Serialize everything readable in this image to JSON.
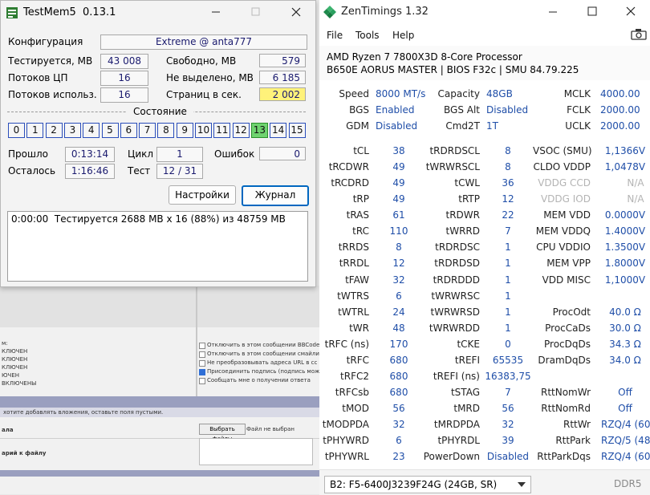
{
  "testmem": {
    "title": "TestMem5  0.13.1",
    "config_label": "Конфигурация",
    "config_value": "Extreme @ anta777",
    "tested_label": "Тестируется, МВ",
    "tested_value": "43 008",
    "free_label": "Свободно, МВ",
    "free_value": "579",
    "cpu_threads_label": "Потоков ЦП",
    "cpu_threads_value": "16",
    "unallocated_label": "Не выделено, МВ",
    "unallocated_value": "6 185",
    "used_threads_label": "Потоков использ.",
    "used_threads_value": "16",
    "pages_label": "Страниц в сек.",
    "pages_value": "2 002",
    "state_label": "Состояние",
    "segments": [
      "0",
      "1",
      "2",
      "3",
      "4",
      "5",
      "6",
      "7",
      "8",
      "9",
      "10",
      "11",
      "12",
      "13",
      "14",
      "15"
    ],
    "active_segment": "13",
    "elapsed_label": "Прошло",
    "elapsed_value": "0:13:14",
    "cycle_label": "Цикл",
    "cycle_value": "1",
    "errors_label": "Ошибок",
    "errors_value": "0",
    "remaining_label": "Осталось",
    "remaining_value": "1:16:46",
    "test_label": "Тест",
    "test_value": "12 / 31",
    "settings_button": "Настройки",
    "log_button": "Журнал",
    "log_line": "0:00:00  Тестируется 2688 МВ x 16 (88%) из 48759 МВ"
  },
  "background": {
    "items": [
      "Отключить в этом сообщении BBCode",
      "Отключить в этом сообщении смайлик",
      "Не преобразовывать адреса URL в сс",
      "Присоединить подпись (подпись можн",
      "Сообщать мне о получении ответа"
    ],
    "left_fragments": [
      "м:",
      "КЛЮЧЕН",
      "КЛЮЧЕН",
      "КЛЮЧЕН",
      "ЮЧЕН",
      "ВКЛЮЧЕНЫ"
    ],
    "attach_hint": "хотите добавлять вложения, оставьте поля пустыми.",
    "file_label": "ала",
    "comment_label": "арий к файлу",
    "choose_file_button": "Выбрать файлы",
    "no_file_text": "Файл не выбран"
  },
  "zentimings": {
    "title": "ZenTimings 1.32",
    "menu": [
      "File",
      "Tools",
      "Help"
    ],
    "cpu": "AMD Ryzen 7 7800X3D 8-Core Processor",
    "board": "B650E AORUS MASTER | BIOS F32c | SMU 84.79.225",
    "top_rows": [
      {
        "l1": "Speed",
        "v1": "8000 MT/s",
        "l2": "Capacity",
        "v2": "48GB",
        "l3": "MCLK",
        "v3": "4000.00"
      },
      {
        "l1": "BGS",
        "v1": "Enabled",
        "l2": "BGS Alt",
        "v2": "Disabled",
        "l3": "FCLK",
        "v3": "2000.00"
      },
      {
        "l1": "GDM",
        "v1": "Disabled",
        "l2": "Cmd2T",
        "v2": "1T",
        "l3": "UCLK",
        "v3": "2000.00"
      }
    ],
    "timing_rows": [
      {
        "l1": "tCL",
        "v1": "38",
        "l2": "tRDRDSCL",
        "v2": "8",
        "l3": "VSOC (SMU)",
        "v3": "1,1366V",
        "dis": false
      },
      {
        "l1": "tRCDWR",
        "v1": "49",
        "l2": "tWRWRSCL",
        "v2": "8",
        "l3": "CLDO VDDP",
        "v3": "1,0478V",
        "dis": false
      },
      {
        "l1": "tRCDRD",
        "v1": "49",
        "l2": "tCWL",
        "v2": "36",
        "l3": "VDDG CCD",
        "v3": "N/A",
        "dis": true
      },
      {
        "l1": "tRP",
        "v1": "49",
        "l2": "tRTP",
        "v2": "12",
        "l3": "VDDG IOD",
        "v3": "N/A",
        "dis": true
      },
      {
        "l1": "tRAS",
        "v1": "61",
        "l2": "tRDWR",
        "v2": "22",
        "l3": "MEM VDD",
        "v3": "0.0000V",
        "dis": false
      },
      {
        "l1": "tRC",
        "v1": "110",
        "l2": "tWRRD",
        "v2": "7",
        "l3": "MEM VDDQ",
        "v3": "1.4000V",
        "dis": false
      },
      {
        "l1": "tRRDS",
        "v1": "8",
        "l2": "tRDRDSC",
        "v2": "1",
        "l3": "CPU VDDIO",
        "v3": "1.3500V",
        "dis": false
      },
      {
        "l1": "tRRDL",
        "v1": "12",
        "l2": "tRDRDSD",
        "v2": "1",
        "l3": "MEM VPP",
        "v3": "1.8000V",
        "dis": false
      },
      {
        "l1": "tFAW",
        "v1": "32",
        "l2": "tRDRDDD",
        "v2": "1",
        "l3": "VDD MISC",
        "v3": "1,1000V",
        "dis": false
      },
      {
        "l1": "tWTRS",
        "v1": "6",
        "l2": "tWRWRSC",
        "v2": "1",
        "l3": "",
        "v3": "",
        "dis": false
      },
      {
        "l1": "tWTRL",
        "v1": "24",
        "l2": "tWRWRSD",
        "v2": "1",
        "l3": "ProcOdt",
        "v3": "40.0 Ω",
        "dis": false
      },
      {
        "l1": "tWR",
        "v1": "48",
        "l2": "tWRWRDD",
        "v2": "1",
        "l3": "ProcCaDs",
        "v3": "30.0 Ω",
        "dis": false
      },
      {
        "l1": "tRFC (ns)",
        "v1": "170",
        "l2": "tCKE",
        "v2": "0",
        "l3": "ProcDqDs",
        "v3": "34.3 Ω",
        "dis": false
      },
      {
        "l1": "tRFC",
        "v1": "680",
        "l2": "tREFI",
        "v2": "65535",
        "l3": "DramDqDs",
        "v3": "34.0 Ω",
        "dis": false
      },
      {
        "l1": "tRFC2",
        "v1": "680",
        "l2": "tREFI (ns)",
        "v2": "16383,75",
        "l3": "",
        "v3": "",
        "dis": false
      },
      {
        "l1": "tRFCsb",
        "v1": "680",
        "l2": "tSTAG",
        "v2": "7",
        "l3": "RttNomWr",
        "v3": "Off",
        "dis": false
      },
      {
        "l1": "tMOD",
        "v1": "56",
        "l2": "tMRD",
        "v2": "56",
        "l3": "RttNomRd",
        "v3": "Off",
        "dis": false
      },
      {
        "l1": "tMODPDA",
        "v1": "32",
        "l2": "tMRDPDA",
        "v2": "32",
        "l3": "RttWr",
        "v3": "RZQ/4 (60)",
        "dis": false
      },
      {
        "l1": "tPHYWRD",
        "v1": "6",
        "l2": "tPHYRDL",
        "v2": "39",
        "l3": "RttPark",
        "v3": "RZQ/5 (48)",
        "dis": false
      },
      {
        "l1": "tPHYWRL",
        "v1": "23",
        "l2": "PowerDown",
        "v2": "Disabled",
        "l3": "RttParkDqs",
        "v3": "RZQ/4 (60)",
        "dis": false
      }
    ],
    "dimm_select": "B2: F5-6400J3239F24G (24GB, SR)",
    "mem_type": "DDR5"
  }
}
